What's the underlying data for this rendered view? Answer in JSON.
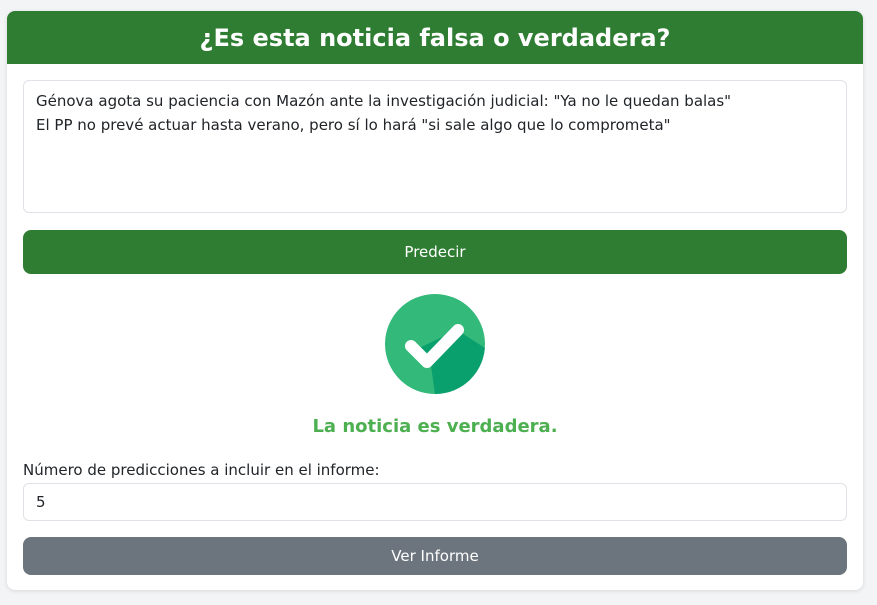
{
  "header": {
    "title": "¿Es esta noticia falsa o verdadera?"
  },
  "news_input": {
    "value": "Génova agota su paciencia con Mazón ante la investigación judicial: \"Ya no le quedan balas\"\nEl PP no prevé actuar hasta verano, pero sí lo hará \"si sale algo que lo comprometa\""
  },
  "predict_button": {
    "label": "Predecir"
  },
  "result": {
    "icon": "check-circle-icon",
    "text": "La noticia es verdadera.",
    "color": "#4caf50",
    "icon_color": "#33b97a"
  },
  "report": {
    "count_label": "Número de predicciones a incluir en el informe:",
    "count_value": "5",
    "button_label": "Ver Informe"
  },
  "colors": {
    "primary": "#2e7d32",
    "secondary": "#6c757d"
  }
}
